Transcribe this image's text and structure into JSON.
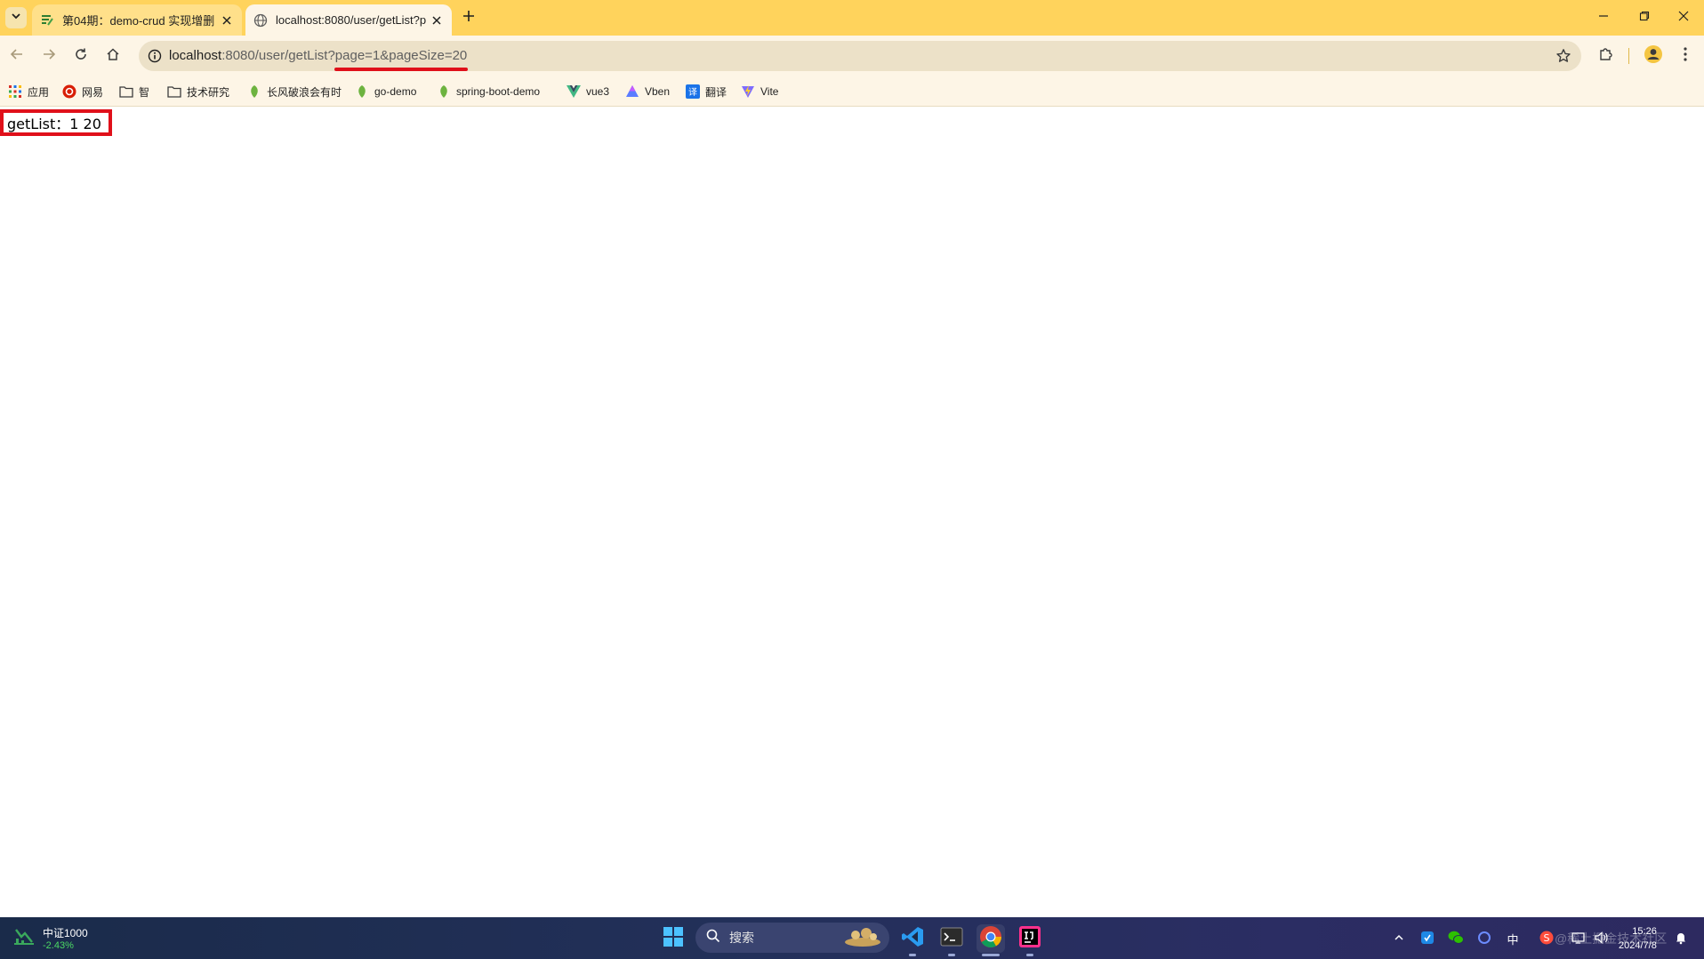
{
  "tabs": [
    {
      "title": "第04期：demo-crud 实现增删",
      "icon": "doc-icon",
      "active": false
    },
    {
      "title": "localhost:8080/user/getList?p",
      "icon": "globe-icon",
      "active": true
    }
  ],
  "address_bar": {
    "host": "localhost",
    "rest": ":8080/user/getList?page=1&pageSize=20"
  },
  "bookmarks": [
    {
      "label": "应用",
      "icon": "apps-grid-icon"
    },
    {
      "label": "网易",
      "icon": "netease-icon"
    },
    {
      "label": "智",
      "icon": "folder-icon"
    },
    {
      "label": "技术研究",
      "icon": "folder-icon"
    },
    {
      "label": "长风破浪会有时",
      "icon": "leaf-icon"
    },
    {
      "label": "go-demo",
      "icon": "leaf-icon"
    },
    {
      "label": "spring-boot-demo",
      "icon": "leaf-icon"
    },
    {
      "label": "vue3",
      "icon": "vue-icon"
    },
    {
      "label": "Vben",
      "icon": "vben-icon"
    },
    {
      "label": "翻译",
      "icon": "translate-icon"
    },
    {
      "label": "Vite",
      "icon": "vite-icon"
    }
  ],
  "page": {
    "result_text": "getList：1 20"
  },
  "taskbar": {
    "widget_title": "中证1000",
    "widget_change": "-2.43%",
    "search_placeholder": "搜索",
    "tray_ime": "中",
    "clock_time": "15:26",
    "clock_date": "2024/7/8",
    "watermark": "@稀土掘金技术社区"
  },
  "colors": {
    "titlebar": "#ffd35c",
    "highlight": "#e0101a",
    "stock_down": "#4cd964"
  }
}
